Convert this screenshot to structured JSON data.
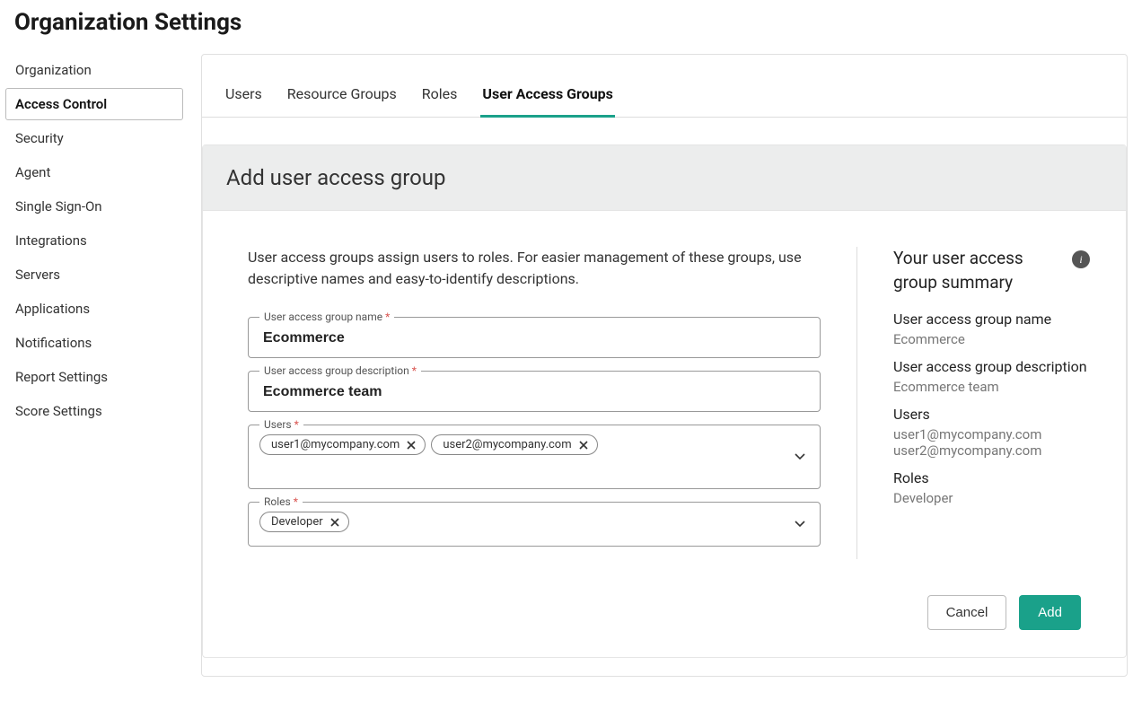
{
  "page_title": "Organization Settings",
  "sidebar": {
    "items": [
      {
        "label": "Organization",
        "active": false
      },
      {
        "label": "Access Control",
        "active": true
      },
      {
        "label": "Security",
        "active": false
      },
      {
        "label": "Agent",
        "active": false
      },
      {
        "label": "Single Sign-On",
        "active": false
      },
      {
        "label": "Integrations",
        "active": false
      },
      {
        "label": "Servers",
        "active": false
      },
      {
        "label": "Applications",
        "active": false
      },
      {
        "label": "Notifications",
        "active": false
      },
      {
        "label": "Report Settings",
        "active": false
      },
      {
        "label": "Score Settings",
        "active": false
      }
    ]
  },
  "tabs": [
    {
      "label": "Users",
      "active": false
    },
    {
      "label": "Resource Groups",
      "active": false
    },
    {
      "label": "Roles",
      "active": false
    },
    {
      "label": "User Access Groups",
      "active": true
    }
  ],
  "panel": {
    "title": "Add user access group",
    "intro": "User access groups assign users to roles. For easier management of these groups, use descriptive names and easy-to-identify descriptions.",
    "fields": {
      "name": {
        "label": "User access group name",
        "required_marker": "*",
        "value": "Ecommerce"
      },
      "description": {
        "label": "User access group description",
        "required_marker": "*",
        "value": "Ecommerce team"
      },
      "users": {
        "label": "Users",
        "required_marker": "*",
        "chips": [
          "user1@mycompany.com",
          "user2@mycompany.com"
        ]
      },
      "roles": {
        "label": "Roles",
        "required_marker": "*",
        "chips": [
          "Developer"
        ]
      }
    },
    "summary": {
      "title": "Your user access group summary",
      "name_label": "User access group name",
      "name_value": "Ecommerce",
      "description_label": "User access group description",
      "description_value": "Ecommerce team",
      "users_label": "Users",
      "users_value_1": "user1@mycompany.com",
      "users_value_2": "user2@mycompany.com",
      "roles_label": "Roles",
      "roles_value": "Developer"
    },
    "actions": {
      "cancel": "Cancel",
      "add": "Add"
    }
  }
}
